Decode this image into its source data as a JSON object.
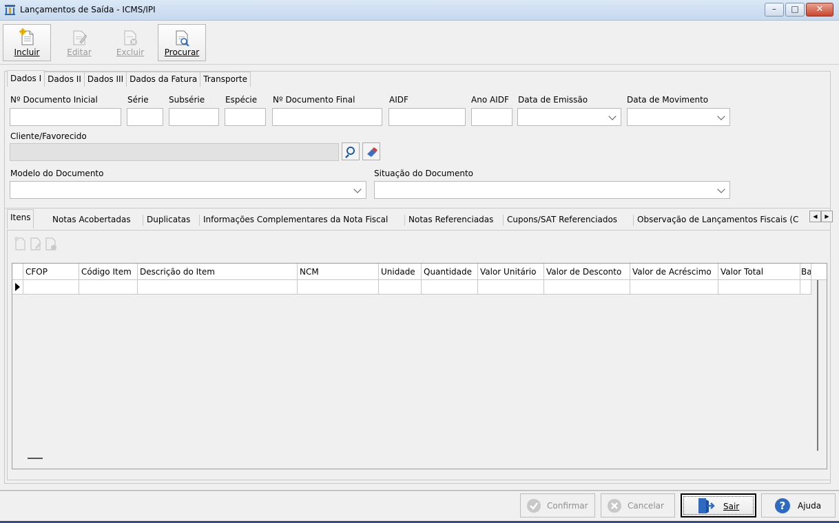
{
  "window": {
    "title": "Lançamentos de Saída - ICMS/IPI",
    "controls": [
      "minimize",
      "maximize",
      "close"
    ]
  },
  "toolbar": {
    "buttons": [
      {
        "label": "Incluir",
        "icon": "new-document-icon",
        "enabled": true
      },
      {
        "label": "Editar",
        "icon": "edit-document-icon",
        "enabled": false
      },
      {
        "label": "Excluir",
        "icon": "delete-document-icon",
        "enabled": false
      },
      {
        "label": "Procurar",
        "icon": "search-document-icon",
        "enabled": true
      }
    ]
  },
  "top_tabs": [
    "Dados I",
    "Dados II",
    "Dados III",
    "Dados da Fatura",
    "Transporte"
  ],
  "active_top_tab": "Dados I",
  "form": {
    "num_doc_inicial": {
      "label": "Nº Documento Inicial",
      "value": ""
    },
    "serie": {
      "label": "Série",
      "value": ""
    },
    "subserie": {
      "label": "Subsérie",
      "value": ""
    },
    "especie": {
      "label": "Espécie",
      "value": ""
    },
    "num_doc_final": {
      "label": "Nº Documento Final",
      "value": ""
    },
    "aidf": {
      "label": "AIDF",
      "value": ""
    },
    "ano_aidf": {
      "label": "Ano AIDF",
      "value": ""
    },
    "data_emissao": {
      "label": "Data de Emissão",
      "value": ""
    },
    "data_movimento": {
      "label": "Data de Movimento",
      "value": ""
    },
    "cliente": {
      "label": "Cliente/Favorecido",
      "value": ""
    },
    "modelo": {
      "label": "Modelo do Documento",
      "value": ""
    },
    "situacao": {
      "label": "Situação do Documento",
      "value": ""
    }
  },
  "bottom_tabs": [
    "Itens",
    "Notas Acobertadas",
    "Duplicatas",
    "Informações Complementares da Nota Fiscal",
    "Notas Referenciadas",
    "Cupons/SAT Referenciados",
    "Observação de Lançamentos Fiscais (C"
  ],
  "active_bottom_tab": "Itens",
  "grid": {
    "columns": [
      "CFOP",
      "Código Item",
      "Descrição do Item",
      "NCM",
      "Unidade",
      "Quantidade",
      "Valor Unitário",
      "Valor de Desconto",
      "Valor de Acréscimo",
      "Valor Total",
      "Ba"
    ]
  },
  "footer": {
    "confirmar": "Confirmar",
    "cancelar": "Cancelar",
    "sair": "Sair",
    "ajuda": "Ajuda"
  }
}
